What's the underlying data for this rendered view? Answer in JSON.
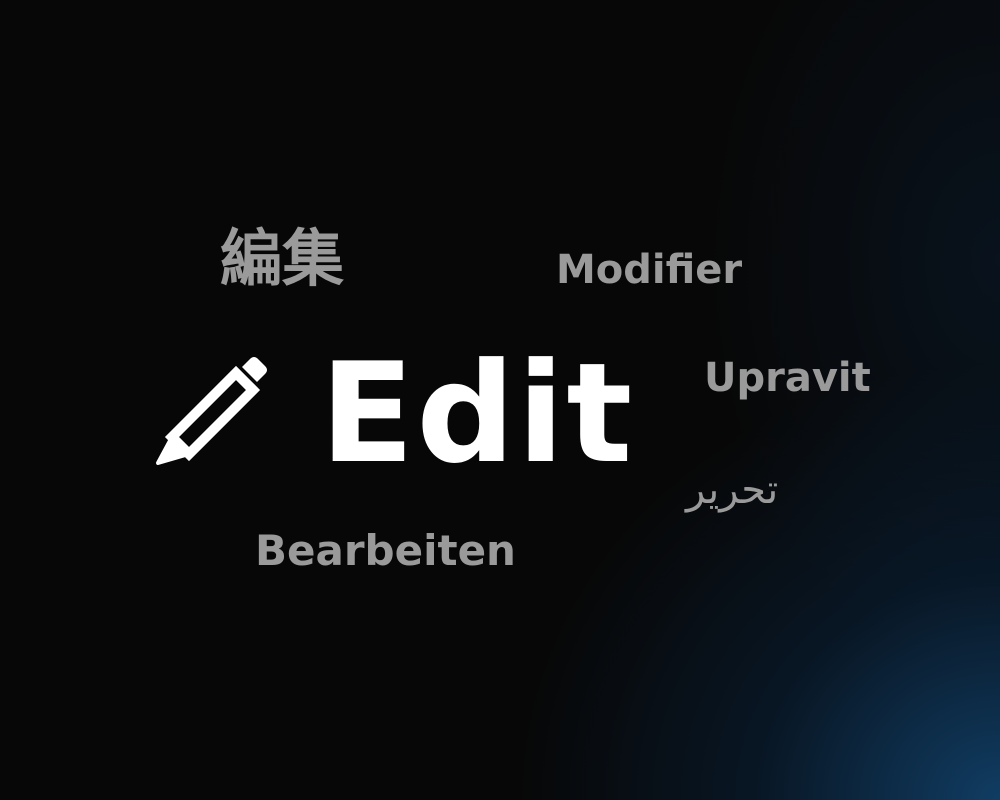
{
  "title": {
    "label": "Edit",
    "icon": "pencil-icon"
  },
  "translations": {
    "japanese": "編集",
    "french": "Modifier",
    "czech": "Upravit",
    "arabic": "تحرير",
    "german": "Bearbeiten"
  },
  "colors": {
    "background": "#070707",
    "glow": "#124673",
    "primary_text": "#ffffff",
    "secondary_text": "#9a9a9a"
  }
}
